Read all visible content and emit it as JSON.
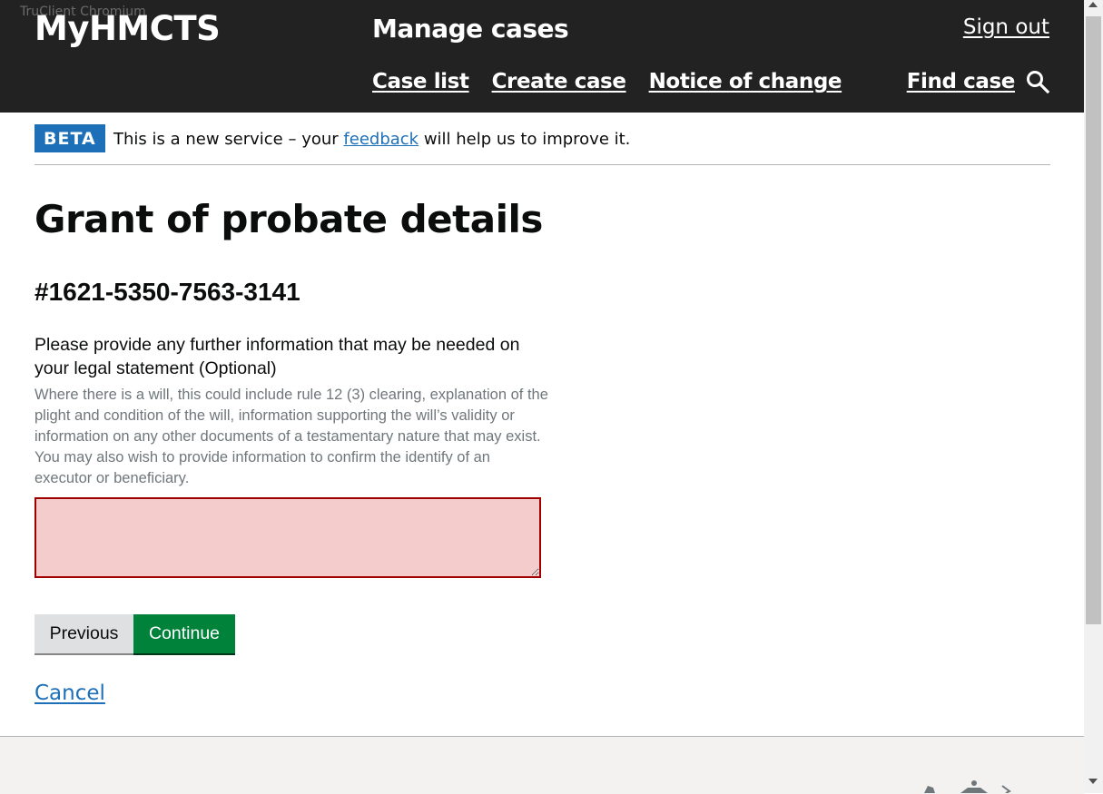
{
  "watermark": "TruClient Chromium",
  "header": {
    "brand": "MyHMCTS",
    "service": "Manage cases",
    "sign_out": "Sign out",
    "nav": [
      "Case list",
      "Create case",
      "Notice of change"
    ],
    "find_case": "Find case",
    "search_icon": "search-icon"
  },
  "beta": {
    "tag": "BETA",
    "text_before": "This is a new service – your ",
    "link": "feedback",
    "text_after": " will help us to improve it."
  },
  "page": {
    "title": "Grant of probate details",
    "case_reference": "#1621-5350-7563-3141"
  },
  "form": {
    "label": "Please provide any further information that may be needed on your legal statement (Optional)",
    "hint": "Where there is a will, this could include rule 12 (3) clearing, explanation of the plight and condition of the will, information supporting the will’s validity or information on any other documents of a testamentary nature that may exist. You may also wish to provide information to confirm the identify of an executor or beneficiary.",
    "value": "",
    "error_color": "#a00000"
  },
  "actions": {
    "previous": "Previous",
    "continue": "Continue",
    "cancel": "Cancel"
  },
  "colors": {
    "header_bg": "#222222",
    "link": "#1d70b8",
    "primary_button": "#00823b",
    "error_field_bg": "#f4cccc"
  }
}
